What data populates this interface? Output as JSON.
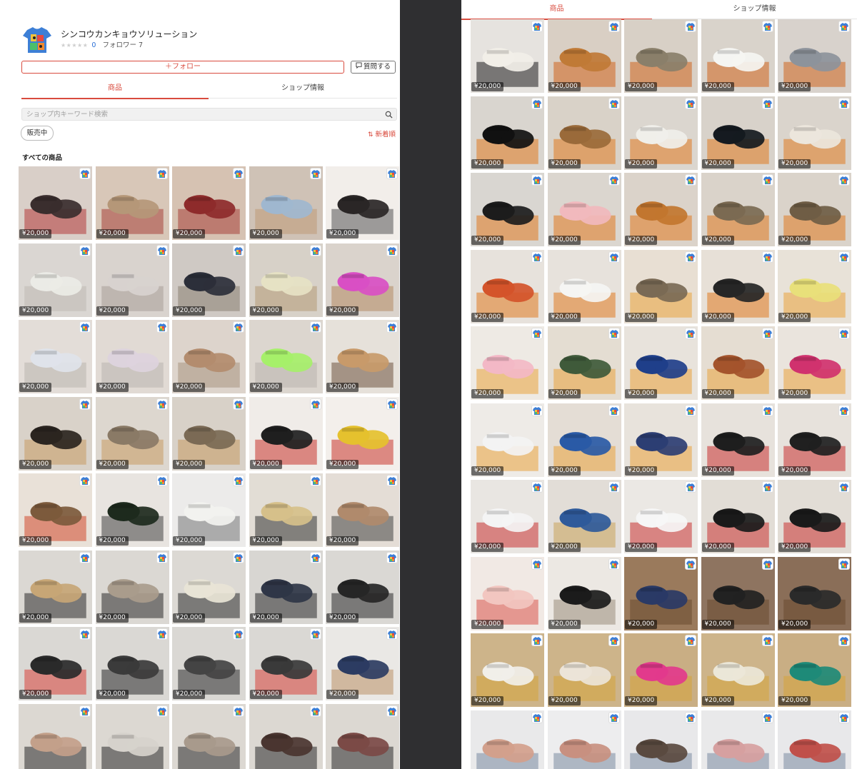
{
  "shop": {
    "name": "シンコウカンキョウソリューション",
    "stars": "★★★★★",
    "rating_count": "0",
    "follower_label": "フォロワー 7",
    "follow_button": "＋フォロー",
    "ask_button": "質問する"
  },
  "tabs": [
    {
      "label": "商品",
      "active": true
    },
    {
      "label": "ショップ情報",
      "active": false
    }
  ],
  "search": {
    "placeholder": "ショップ内キーワード検索",
    "icon": "search-icon"
  },
  "filter": {
    "chip_label": "販売中",
    "sort_label": "新着順",
    "sort_icon": "sort-arrows-icon"
  },
  "section_title": "すべての商品",
  "colors": {
    "accent": "#d94b3e",
    "price_bg": "#00000088"
  },
  "left_products": [
    {
      "price": "¥20,000",
      "bg": "#d9cfc8",
      "main": "#3a2e2e",
      "accent": "#b33a3a"
    },
    {
      "price": "¥20,000",
      "bg": "#d8c7b8",
      "main": "#b59778",
      "accent": "#a8423a"
    },
    {
      "price": "¥20,000",
      "bg": "#d6c2b2",
      "main": "#8e2b2b",
      "accent": "#a8423a"
    },
    {
      "price": "¥20,000",
      "bg": "#cfc2b6",
      "main": "#9fb7cf",
      "accent": "#c09a77"
    },
    {
      "price": "¥20,000",
      "bg": "#f2eeea",
      "main": "#2a2626",
      "accent": "#555555"
    },
    {
      "price": "¥20,000",
      "bg": "#dad6d2",
      "main": "#ebebe6",
      "accent": "#bfb9b2"
    },
    {
      "price": "¥20,000",
      "bg": "#d9d3ce",
      "main": "#d8d2cf",
      "accent": "#a89f98"
    },
    {
      "price": "¥20,000",
      "bg": "#cfc9c4",
      "main": "#2c2f3a",
      "accent": "#8a7f73"
    },
    {
      "price": "¥20,000",
      "bg": "#d7d1c8",
      "main": "#e6e2c4",
      "accent": "#b59a77"
    },
    {
      "price": "¥20,000",
      "bg": "#dad3cc",
      "main": "#d94fc4",
      "accent": "#b58a62"
    },
    {
      "price": "¥20,000",
      "bg": "#e3ddd8",
      "main": "#dfe3ea",
      "accent": "#b9b4ae"
    },
    {
      "price": "¥20,000",
      "bg": "#e1dad4",
      "main": "#ddd3dd",
      "accent": "#b9b4ae"
    },
    {
      "price": "¥20,000",
      "bg": "#ddd4cc",
      "main": "#b38c6e",
      "accent": "#a89480"
    },
    {
      "price": "¥20,000",
      "bg": "#dcd6cf",
      "main": "#a6f06a",
      "accent": "#b9b4ae"
    },
    {
      "price": "¥20,000",
      "bg": "#e6e1da",
      "main": "#c89a6a",
      "accent": "#6d5440"
    },
    {
      "price": "¥20,000",
      "bg": "#d9d2c9",
      "main": "#2b2520",
      "accent": "#c79b62"
    },
    {
      "price": "¥20,000",
      "bg": "#ddd7cf",
      "main": "#8a7a66",
      "accent": "#c79b62"
    },
    {
      "price": "¥20,000",
      "bg": "#d8d1c8",
      "main": "#7b6a55",
      "accent": "#c79b62"
    },
    {
      "price": "¥20,000",
      "bg": "#f0ece8",
      "main": "#1f1f1f",
      "accent": "#c8342b"
    },
    {
      "price": "¥20,000",
      "bg": "#f3efeb",
      "main": "#e5c12e",
      "accent": "#c8342b"
    },
    {
      "price": "¥20,000",
      "bg": "#e9e1d8",
      "main": "#7c5a3c",
      "accent": "#d24b2e"
    },
    {
      "price": "¥20,000",
      "bg": "#e8e4e0",
      "main": "#1d2a1d",
      "accent": "#444444"
    },
    {
      "price": "¥20,000",
      "bg": "#ecebea",
      "main": "#f2f2ef",
      "accent": "#777777"
    },
    {
      "price": "¥20,000",
      "bg": "#e2ddd5",
      "main": "#d6c08a",
      "accent": "#333333"
    },
    {
      "price": "¥20,000",
      "bg": "#e4ddd6",
      "main": "#b08a6c",
      "accent": "#444444"
    },
    {
      "price": "¥20,000",
      "bg": "#dbd8d3",
      "main": "#c7a676",
      "accent": "#2b2b2b"
    },
    {
      "price": "¥20,000",
      "bg": "#dbd8d3",
      "main": "#a99c8c",
      "accent": "#2b2b2b"
    },
    {
      "price": "¥20,000",
      "bg": "#dcd9d4",
      "main": "#e8e4d6",
      "accent": "#2b2b2b"
    },
    {
      "price": "¥20,000",
      "bg": "#d8d6d2",
      "main": "#2f3647",
      "accent": "#2b2b2b"
    },
    {
      "price": "¥20,000",
      "bg": "#dad8d4",
      "main": "#262626",
      "accent": "#2b2b2b"
    },
    {
      "price": "¥20,000",
      "bg": "#dad8d4",
      "main": "#2a2a2a",
      "accent": "#d9443a"
    },
    {
      "price": "¥20,000",
      "bg": "#dad8d4",
      "main": "#3b3b3b",
      "accent": "#2b2b2b"
    },
    {
      "price": "¥20,000",
      "bg": "#dad8d4",
      "main": "#444444",
      "accent": "#2b2b2b"
    },
    {
      "price": "¥20,000",
      "bg": "#dad8d4",
      "main": "#3a3a3a",
      "accent": "#d9443a"
    },
    {
      "price": "¥20,000",
      "bg": "#eae8e5",
      "main": "#2c3c62",
      "accent": "#b99066"
    },
    {
      "price": "",
      "bg": "#dcd8d2",
      "main": "#c3a08a",
      "accent": "#2b2b2b"
    },
    {
      "price": "",
      "bg": "#dcd8d2",
      "main": "#d6d2cc",
      "accent": "#2b2b2b"
    },
    {
      "price": "",
      "bg": "#dcd8d2",
      "main": "#a89a8c",
      "accent": "#2b2b2b"
    },
    {
      "price": "",
      "bg": "#dcd8d2",
      "main": "#4a3530",
      "accent": "#2b2b2b"
    },
    {
      "price": "",
      "bg": "#dcd8d2",
      "main": "#7b4a46",
      "accent": "#2b2b2b"
    }
  ],
  "right_products": [
    {
      "price": "¥20,000",
      "bg": "#e6e3df",
      "main": "#f2efe8",
      "accent": "#1e1e1e"
    },
    {
      "price": "¥20,000",
      "bg": "#d9cfc4",
      "main": "#c07a36",
      "accent": "#d0651d"
    },
    {
      "price": "¥20,000",
      "bg": "#d8d0c6",
      "main": "#8a7f6a",
      "accent": "#d0651d"
    },
    {
      "price": "¥20,000",
      "bg": "#d9d3cb",
      "main": "#f5f5f2",
      "accent": "#d0651d"
    },
    {
      "price": "¥20,000",
      "bg": "#d8d2cc",
      "main": "#8d939b",
      "accent": "#d0651d"
    },
    {
      "price": "¥20,000",
      "bg": "#d9d5cf",
      "main": "#111111",
      "accent": "#e07a20"
    },
    {
      "price": "¥20,000",
      "bg": "#d9d2c8",
      "main": "#9a6a3a",
      "accent": "#e07a20"
    },
    {
      "price": "¥20,000",
      "bg": "#dbd6cf",
      "main": "#f0efea",
      "accent": "#e07a20"
    },
    {
      "price": "¥20,000",
      "bg": "#d8d2ca",
      "main": "#151a20",
      "accent": "#e07a20"
    },
    {
      "price": "¥20,000",
      "bg": "#dad4cc",
      "main": "#ece6dc",
      "accent": "#e07a20"
    },
    {
      "price": "¥20,000",
      "bg": "#d9d6d1",
      "main": "#1c1c1c",
      "accent": "#e07a20"
    },
    {
      "price": "¥20,000",
      "bg": "#dbd6cf",
      "main": "#f1b9bd",
      "accent": "#e07a20"
    },
    {
      "price": "¥20,000",
      "bg": "#dbd3ca",
      "main": "#c2762f",
      "accent": "#e07a20"
    },
    {
      "price": "¥20,000",
      "bg": "#dad3ca",
      "main": "#7b6a52",
      "accent": "#e07a20"
    },
    {
      "price": "¥20,000",
      "bg": "#dad3ca",
      "main": "#6f5d45",
      "accent": "#e07a20"
    },
    {
      "price": "¥20,000",
      "bg": "#e7e2dc",
      "main": "#d4542a",
      "accent": "#e07a20"
    },
    {
      "price": "¥20,000",
      "bg": "#e7e2dc",
      "main": "#f5f5f3",
      "accent": "#e07a20"
    },
    {
      "price": "¥20,000",
      "bg": "#e8dfd3",
      "main": "#7a6a55",
      "accent": "#e9a23c"
    },
    {
      "price": "¥20,000",
      "bg": "#e7e0d7",
      "main": "#262626",
      "accent": "#e07a20"
    },
    {
      "price": "¥20,000",
      "bg": "#e8e2d8",
      "main": "#e8e07a",
      "accent": "#e9a23c"
    },
    {
      "price": "¥20,000",
      "bg": "#eeeae4",
      "main": "#f3b8c6",
      "accent": "#e9a23c"
    },
    {
      "price": "¥20,000",
      "bg": "#e4ddd2",
      "main": "#3f5a3a",
      "accent": "#e9a23c"
    },
    {
      "price": "¥20,000",
      "bg": "#e8e3dc",
      "main": "#1f3f8a",
      "accent": "#e9a23c"
    },
    {
      "price": "¥20,000",
      "bg": "#e5ddd2",
      "main": "#a4542c",
      "accent": "#e9a23c"
    },
    {
      "price": "¥20,000",
      "bg": "#eae4dd",
      "main": "#d0326e",
      "accent": "#e9a23c"
    },
    {
      "price": "¥20,000",
      "bg": "#eeebe7",
      "main": "#f3f3f3",
      "accent": "#e9a23c"
    },
    {
      "price": "¥20,000",
      "bg": "#e4ddd5",
      "main": "#2a5aa6",
      "accent": "#e9a23c"
    },
    {
      "price": "¥20,000",
      "bg": "#e8e3dc",
      "main": "#2c3e73",
      "accent": "#e9a23c"
    },
    {
      "price": "¥20,000",
      "bg": "#e7e2dc",
      "main": "#1e1e1e",
      "accent": "#c83131"
    },
    {
      "price": "¥20,000",
      "bg": "#e7e2dc",
      "main": "#202020",
      "accent": "#c83131"
    },
    {
      "price": "¥20,000",
      "bg": "#e9e6e2",
      "main": "#f4f4f4",
      "accent": "#c83131"
    },
    {
      "price": "¥20,000",
      "bg": "#e2ddd7",
      "main": "#2f5a9a",
      "accent": "#c9a25a"
    },
    {
      "price": "¥20,000",
      "bg": "#ebe8e4",
      "main": "#f6f6f6",
      "accent": "#c83131"
    },
    {
      "price": "¥20,000",
      "bg": "#e2ddd6",
      "main": "#1a1a1a",
      "accent": "#c83131"
    },
    {
      "price": "¥20,000",
      "bg": "#e2ddd6",
      "main": "#1a1a1a",
      "accent": "#c83131"
    },
    {
      "price": "¥20,000",
      "bg": "#f1e9e4",
      "main": "#f2c6c0",
      "accent": "#d8534a"
    },
    {
      "price": "¥20,000",
      "bg": "#ece8e3",
      "main": "#1b1b1b",
      "accent": "#9a8c7c"
    },
    {
      "price": "¥20,000",
      "bg": "#9a7a5c",
      "main": "#2a3a66",
      "accent": "#6a4a30"
    },
    {
      "price": "¥20,000",
      "bg": "#8e7460",
      "main": "#222222",
      "accent": "#6a4a30"
    },
    {
      "price": "¥20,000",
      "bg": "#8a6e58",
      "main": "#2a2a2a",
      "accent": "#6a4a30"
    },
    {
      "price": "¥20,000",
      "bg": "#cdb48a",
      "main": "#f1efe9",
      "accent": "#d6a43b"
    },
    {
      "price": "¥20,000",
      "bg": "#cdb48a",
      "main": "#ece4d8",
      "accent": "#d6a43b"
    },
    {
      "price": "¥20,000",
      "bg": "#c9ae84",
      "main": "#e23a8c",
      "accent": "#d6a43b"
    },
    {
      "price": "¥20,000",
      "bg": "#cdb48a",
      "main": "#ebe7d8",
      "accent": "#d6a43b"
    },
    {
      "price": "¥20,000",
      "bg": "#c9ae84",
      "main": "#1e8a78",
      "accent": "#d6a43b"
    },
    {
      "price": "",
      "bg": "#e9e9ea",
      "main": "#d2a08c",
      "accent": "#7a8aa0"
    },
    {
      "price": "",
      "bg": "#ededee",
      "main": "#c89080",
      "accent": "#7a8aa0"
    },
    {
      "price": "",
      "bg": "#e8e8ea",
      "main": "#5a4a40",
      "accent": "#7a8aa0"
    },
    {
      "price": "",
      "bg": "#e9e9ea",
      "main": "#d6a0a0",
      "accent": "#7a8aa0"
    },
    {
      "price": "",
      "bg": "#e8e8ea",
      "main": "#c0504a",
      "accent": "#7a8aa0"
    }
  ]
}
